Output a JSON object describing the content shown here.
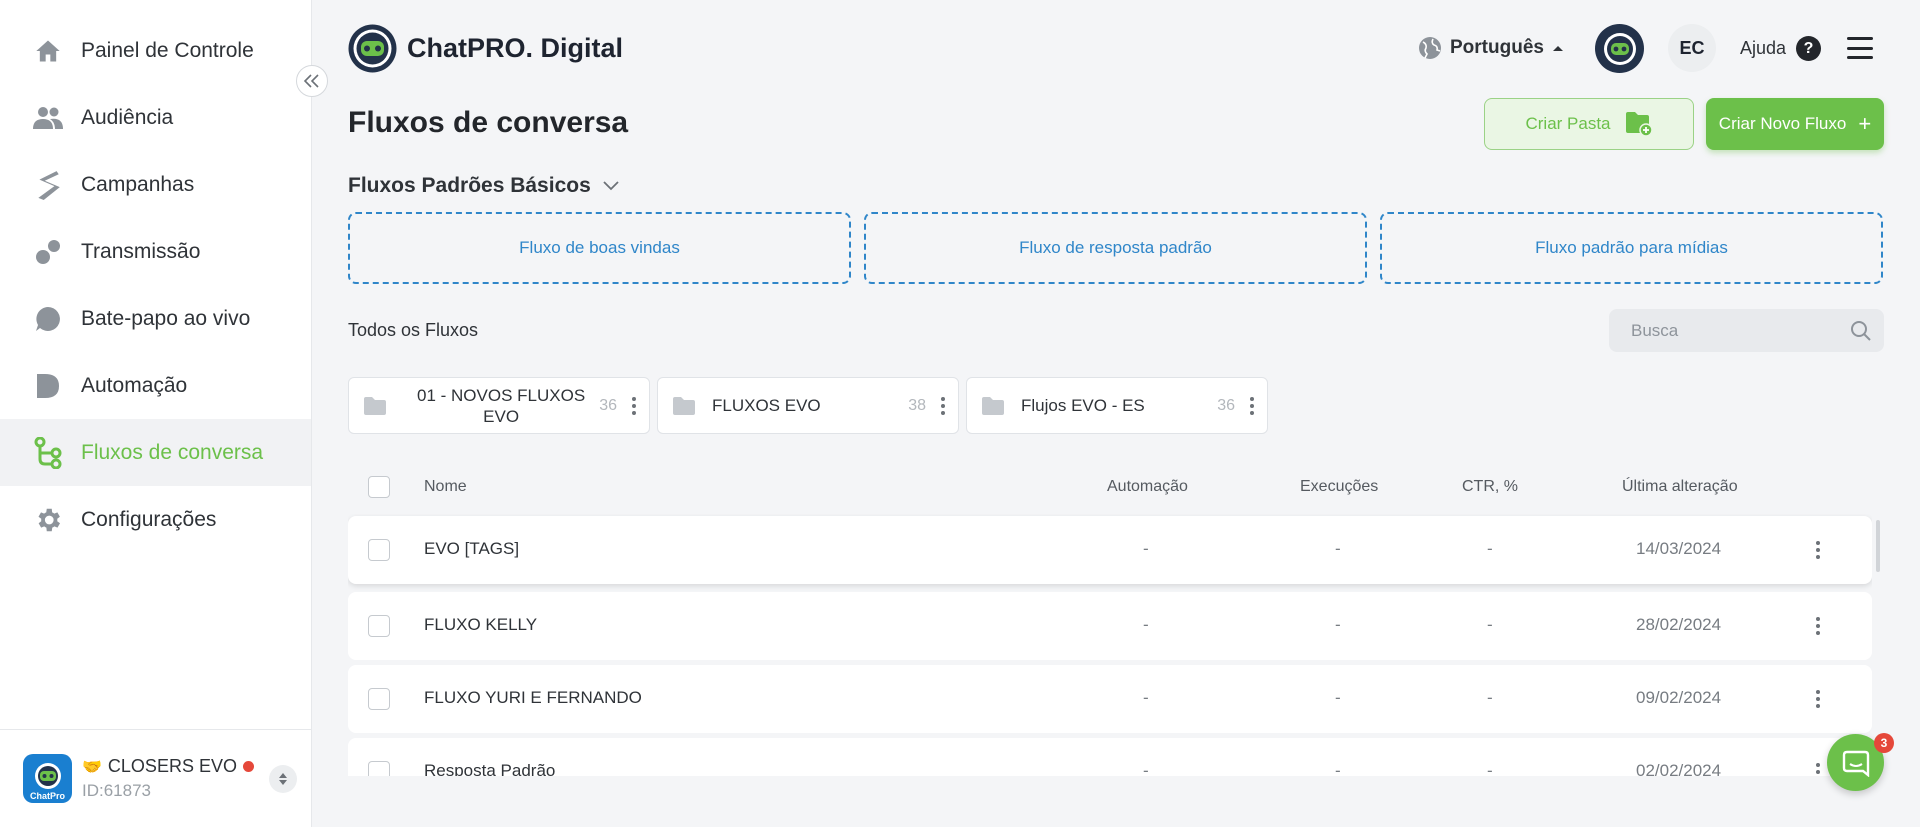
{
  "sidebar": {
    "items": [
      {
        "label": "Painel de Controle",
        "icon": "home-icon"
      },
      {
        "label": "Audiência",
        "icon": "users-icon"
      },
      {
        "label": "Campanhas",
        "icon": "campaign-icon"
      },
      {
        "label": "Transmissão",
        "icon": "broadcast-icon"
      },
      {
        "label": "Bate-papo ao vivo",
        "icon": "chat-bubble-icon"
      },
      {
        "label": "Automação",
        "icon": "automation-icon"
      },
      {
        "label": "Fluxos de conversa",
        "icon": "flow-icon",
        "active": true
      },
      {
        "label": "Configurações",
        "icon": "gear-icon"
      }
    ],
    "account": {
      "name": "CLOSERS EVO",
      "id": "ID:61873",
      "emoji": "🤝",
      "avatar_text": "ChatPro"
    }
  },
  "header": {
    "app_title": "ChatPRO. Digital",
    "language": "Português",
    "user_initials": "EC",
    "help_label": "Ajuda",
    "help_glyph": "?"
  },
  "page": {
    "title": "Fluxos de conversa",
    "create_folder_label": "Criar Pasta",
    "create_flow_label": "Criar Novo Fluxo",
    "create_flow_glyph": "+"
  },
  "basic_flows": {
    "heading": "Fluxos Padrões Básicos",
    "items": [
      "Fluxo de boas vindas",
      "Fluxo de resposta padrão",
      "Fluxo padrão para mídias"
    ]
  },
  "all_flows": {
    "heading": "Todos os Fluxos",
    "search_placeholder": "Busca"
  },
  "folders": [
    {
      "name": "01 - NOVOS FLUXOS EVO",
      "count": "36"
    },
    {
      "name": "FLUXOS EVO",
      "count": "38"
    },
    {
      "name": "Flujos EVO - ES",
      "count": "36"
    }
  ],
  "table": {
    "columns": [
      "Nome",
      "Automação",
      "Execuções",
      "CTR, %",
      "Última alteração"
    ],
    "rows": [
      {
        "name": "EVO [TAGS]",
        "automation": "-",
        "executions": "-",
        "ctr": "-",
        "updated": "14/03/2024"
      },
      {
        "name": "FLUXO KELLY",
        "automation": "-",
        "executions": "-",
        "ctr": "-",
        "updated": "28/02/2024"
      },
      {
        "name": "FLUXO YURI E FERNANDO",
        "automation": "-",
        "executions": "-",
        "ctr": "-",
        "updated": "09/02/2024"
      },
      {
        "name": "Resposta Padrão",
        "automation": "-",
        "executions": "-",
        "ctr": "-",
        "updated": "02/02/2024"
      }
    ]
  },
  "chat_widget": {
    "badge": "3"
  },
  "colors": {
    "accent_green": "#6cc04a",
    "link_blue": "#2f86c9",
    "badge_red": "#e5483a"
  }
}
